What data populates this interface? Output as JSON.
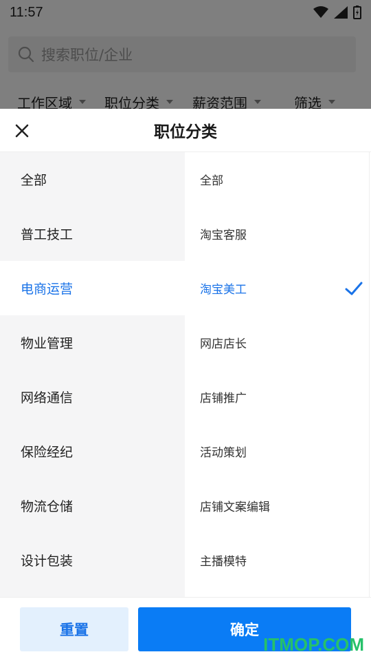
{
  "status_bar": {
    "time": "11:57"
  },
  "search": {
    "placeholder": "搜索职位/企业"
  },
  "filters": [
    {
      "label": "工作区域"
    },
    {
      "label": "职位分类"
    },
    {
      "label": "薪资范围"
    },
    {
      "label": "筛选"
    }
  ],
  "sheet": {
    "title": "职位分类",
    "categories": [
      {
        "label": "全部",
        "selected": false
      },
      {
        "label": "普工技工",
        "selected": false
      },
      {
        "label": "电商运营",
        "selected": true
      },
      {
        "label": "物业管理",
        "selected": false
      },
      {
        "label": "网络通信",
        "selected": false
      },
      {
        "label": "保险经纪",
        "selected": false
      },
      {
        "label": "物流仓储",
        "selected": false
      },
      {
        "label": "设计包装",
        "selected": false
      }
    ],
    "subcategories": [
      {
        "label": "全部",
        "selected": false
      },
      {
        "label": "淘宝客服",
        "selected": false
      },
      {
        "label": "淘宝美工",
        "selected": true
      },
      {
        "label": "网店店长",
        "selected": false
      },
      {
        "label": "店铺推广",
        "selected": false
      },
      {
        "label": "活动策划",
        "selected": false
      },
      {
        "label": "店铺文案编辑",
        "selected": false
      },
      {
        "label": "主播模特",
        "selected": false
      }
    ],
    "reset_label": "重置",
    "confirm_label": "确定"
  },
  "watermark": "ITMOP.COM",
  "colors": {
    "accent": "#1a73e8",
    "primary_button": "#0a7cf5",
    "reset_bg": "#e3f0fd",
    "watermark": "#26c16a"
  },
  "icons": {
    "close": "close-icon",
    "check": "check-icon",
    "search": "search-icon"
  }
}
